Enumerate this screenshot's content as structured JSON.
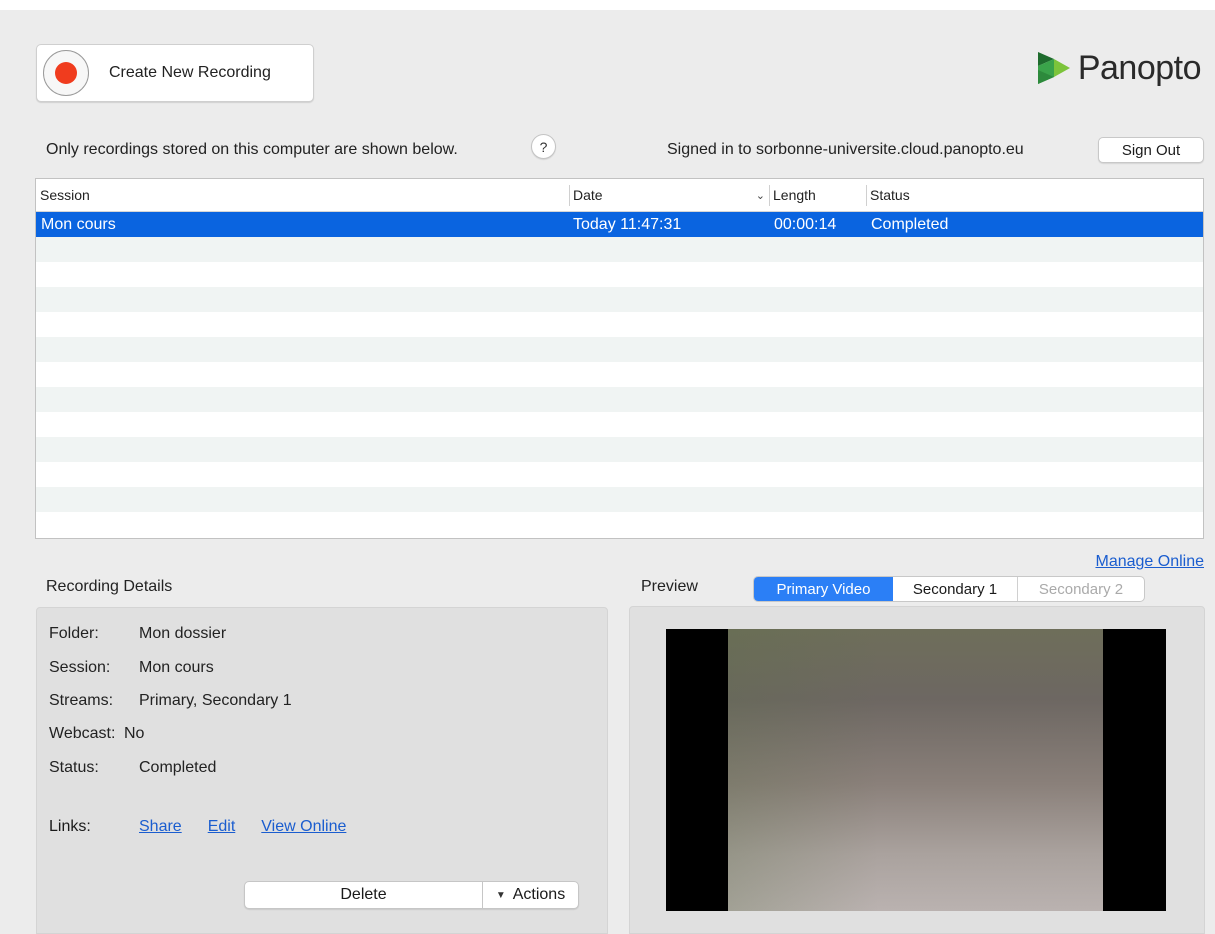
{
  "toolbar": {
    "create_label": "Create New Recording"
  },
  "logo": {
    "text": "Panopto"
  },
  "info": {
    "local_note": "Only recordings stored on this computer are shown below.",
    "help_label": "?",
    "signed_in": "Signed in to sorbonne-universite.cloud.panopto.eu",
    "sign_out_label": "Sign Out"
  },
  "table": {
    "columns": [
      "Session",
      "Date",
      "Length",
      "Status"
    ],
    "sort_icon": "chevron-down-icon",
    "rows": [
      {
        "session": "Mon cours",
        "date": "Today 11:47:31",
        "length": "00:00:14",
        "status": "Completed",
        "selected": true
      }
    ]
  },
  "manage_online": "Manage Online",
  "details": {
    "title": "Recording Details",
    "folder_label": "Folder:",
    "folder": "Mon dossier",
    "session_label": "Session:",
    "session": "Mon cours",
    "streams_label": "Streams:",
    "streams": "Primary, Secondary 1",
    "webcast_label": "Webcast:",
    "webcast": "No",
    "status_label": "Status:",
    "status": "Completed",
    "links_label": "Links:",
    "links": [
      "Share",
      "Edit",
      "View Online"
    ],
    "delete_label": "Delete",
    "actions_label": "Actions"
  },
  "preview": {
    "title": "Preview",
    "tabs": [
      "Primary Video",
      "Secondary 1",
      "Secondary 2"
    ],
    "active_tab": "Primary Video",
    "disabled_tab": "Secondary 2"
  },
  "colors": {
    "selection": "#0a64e0",
    "record": "#f03c1e",
    "link": "#1a5dcf",
    "brand_green": "#3aa34a"
  }
}
